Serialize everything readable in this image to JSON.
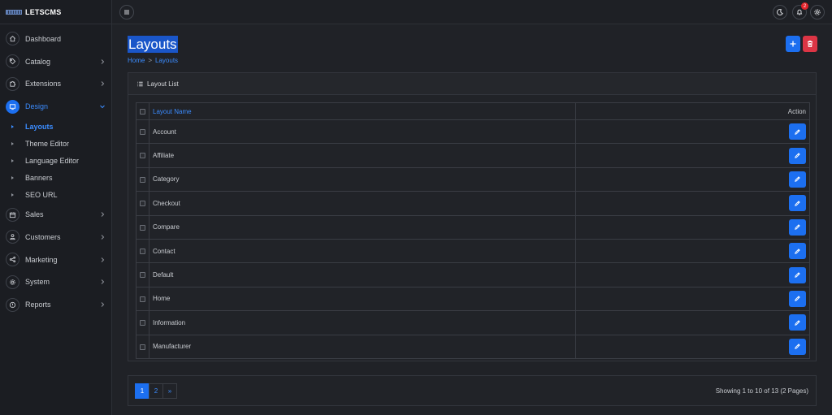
{
  "brand": {
    "name": "LETSCMS"
  },
  "sidebar": {
    "items": [
      {
        "label": "Dashboard",
        "icon": "home-icon",
        "chevron": false
      },
      {
        "label": "Catalog",
        "icon": "tag-icon",
        "chevron": true
      },
      {
        "label": "Extensions",
        "icon": "puzzle-icon",
        "chevron": true
      },
      {
        "label": "Design",
        "icon": "monitor-icon",
        "chevron": true,
        "active": true
      }
    ],
    "design_sub": [
      {
        "label": "Layouts",
        "active": true
      },
      {
        "label": "Theme Editor"
      },
      {
        "label": "Language Editor"
      },
      {
        "label": "Banners"
      },
      {
        "label": "SEO URL"
      }
    ],
    "items_after": [
      {
        "label": "Sales",
        "icon": "cart-icon"
      },
      {
        "label": "Customers",
        "icon": "user-icon"
      },
      {
        "label": "Marketing",
        "icon": "share-icon"
      },
      {
        "label": "System",
        "icon": "gear-icon"
      },
      {
        "label": "Reports",
        "icon": "info-icon"
      }
    ]
  },
  "topbar": {
    "notification_count": "2"
  },
  "page": {
    "title": "Layouts",
    "breadcrumb": {
      "home": "Home",
      "sep": ">",
      "current": "Layouts"
    }
  },
  "card": {
    "header": "Layout List",
    "columns": {
      "name": "Layout Name",
      "action": "Action"
    },
    "rows": [
      "Account",
      "Affiliate",
      "Category",
      "Checkout",
      "Compare",
      "Contact",
      "Default",
      "Home",
      "Information",
      "Manufacturer"
    ]
  },
  "pagination": {
    "pages": [
      "1",
      "2",
      "»"
    ],
    "active": "1",
    "showing": "Showing 1 to 10 of 13 (2 Pages)"
  },
  "colors": {
    "accent": "#1c6ff0",
    "danger": "#dc3545",
    "background": "#202227",
    "sidebar": "#1b1d22"
  }
}
